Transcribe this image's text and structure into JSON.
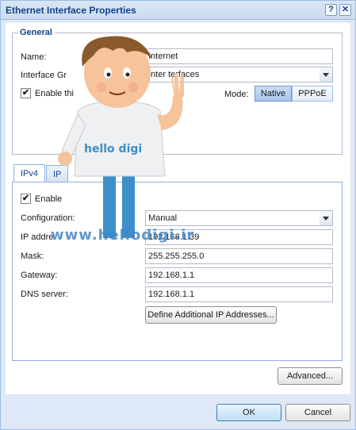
{
  "window": {
    "title": "Ethernet Interface Properties",
    "help_label": "?",
    "close_label": "✕"
  },
  "general": {
    "legend": "General",
    "name_label": "Name:",
    "name_value": "Internet",
    "group_label": "Interface Gr",
    "group_value": "Inter      terfaces",
    "enable_label": "Enable thi",
    "enable_checked": true,
    "mode_label": "Mode:",
    "mode_options": [
      "Native",
      "PPPoE"
    ],
    "mode_selected": "Native"
  },
  "tabs": [
    {
      "label": "IPv4",
      "active": true
    },
    {
      "label": "IP",
      "active": false
    }
  ],
  "ipv4": {
    "enable_label": "Enable",
    "enable_checked": true,
    "config_label": "Configuration:",
    "config_value": "Manual",
    "ip_label": "IP addre",
    "ip_value": "192.168.1.39",
    "mask_label": "Mask:",
    "mask_value": "255.255.255.0",
    "gateway_label": "Gateway:",
    "gateway_value": "192.168.1.1",
    "dns_label": "DNS server:",
    "dns_value": "192.168.1.1",
    "define_button": "Define Additional IP Addresses..."
  },
  "advanced_button": "Advanced...",
  "footer": {
    "ok": "OK",
    "cancel": "Cancel"
  },
  "mascot": {
    "shirt_text": "hello digi",
    "watermark": "www.hellodigi.ir"
  },
  "colors": {
    "title_text": "#15428b",
    "frame": "#dfe8f6",
    "border": "#99bbe8"
  }
}
